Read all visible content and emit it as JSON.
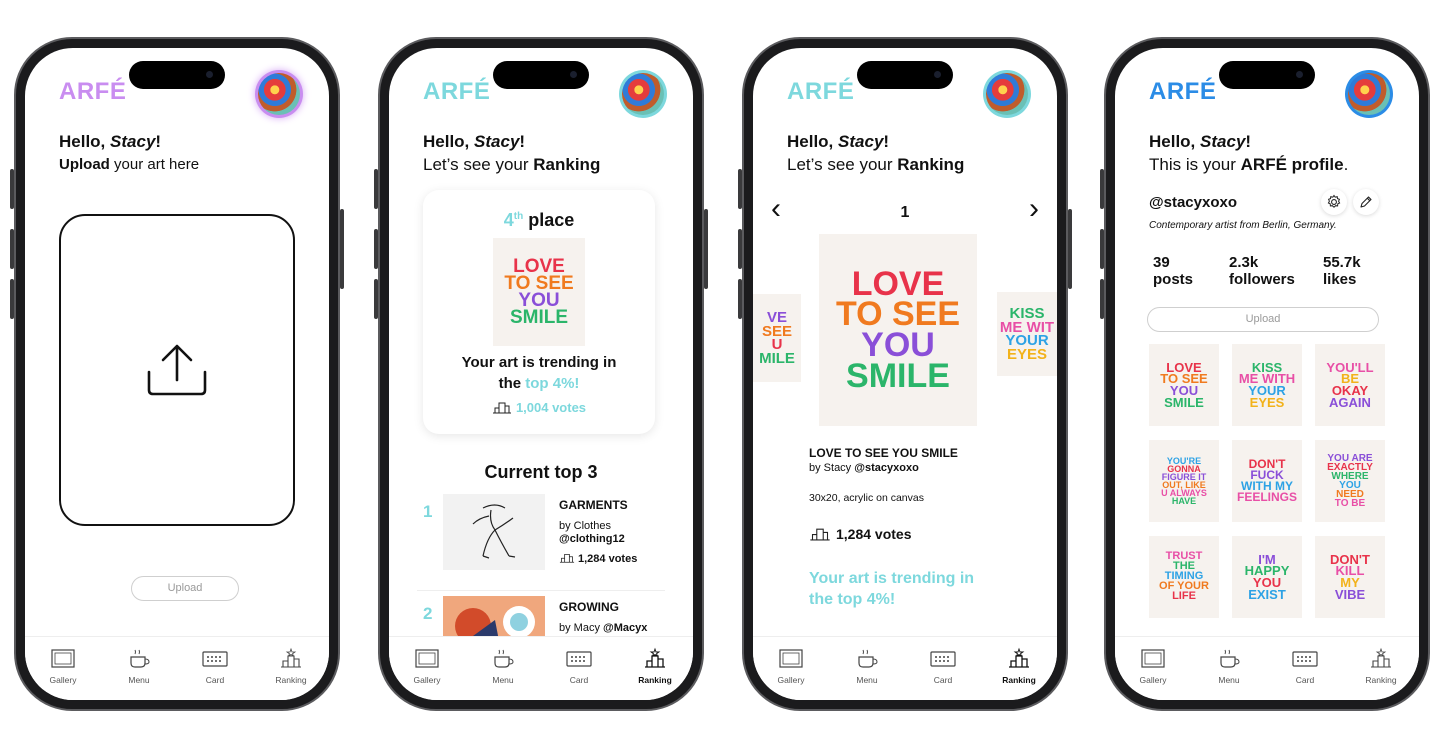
{
  "logo_text": "ARFÉ",
  "nav": [
    {
      "label": "Gallery",
      "icon": "gallery-icon"
    },
    {
      "label": "Menu",
      "icon": "coffee-cup-icon"
    },
    {
      "label": "Card",
      "icon": "card-icon"
    },
    {
      "label": "Ranking",
      "icon": "podium-icon"
    }
  ],
  "phones": [
    {
      "accent": "#c98df0",
      "greeting": "Hello,",
      "name": "Stacy",
      "subtitle_bold": "Upload",
      "subtitle_rest": " your art here",
      "upload_button": "Upload",
      "active_tab": "Gallery"
    },
    {
      "accent": "#7dd8dd",
      "greeting": "Hello,",
      "name": "Stacy",
      "subtitle_rest": "Let’s see your ",
      "subtitle_bold": "Ranking",
      "place_num": "4",
      "place_sup": "th",
      "place_word": " place",
      "art_lines": [
        "LOVE",
        "TO SEE",
        "YOU",
        "SMILE"
      ],
      "trend_line1": "Your art is trending in",
      "trend_line2_pre": "the ",
      "trend_highlight": "top 4%!",
      "votes": "1,004 votes",
      "top3_title": "Current top 3",
      "top3": [
        {
          "rank": "1",
          "title": "GARMENTS",
          "by_prefix": "by Clothes",
          "handle": "@clothing12",
          "votes": "1,284 votes"
        },
        {
          "rank": "2",
          "title": "GROWING",
          "by_prefix": "by Macy",
          "handle": "@Macyx"
        }
      ],
      "active_tab": "Ranking"
    },
    {
      "accent": "#7dd8dd",
      "greeting": "Hello,",
      "name": "Stacy",
      "subtitle_rest": "Let’s see your ",
      "subtitle_bold": "Ranking",
      "pager_prev": "‹",
      "pager_next": "›",
      "pager_number": "1",
      "main_art_lines": [
        "LOVE",
        "TO SEE",
        "YOU",
        "SMILE"
      ],
      "left_art_lines": [
        "VE",
        "SEE",
        "U",
        "MILE"
      ],
      "right_art_lines": [
        "KISS",
        "ME WIT",
        "YOUR",
        "EYES"
      ],
      "art_title": "LOVE TO SEE YOU SMILE",
      "art_by_prefix": "by Stacy",
      "art_handle": "@stacyxoxo",
      "art_meta": "30x20, acrylic on canvas",
      "votes": "1,284 votes",
      "trend_line1": "Your art is trending in",
      "trend_line2": "the top 4%!",
      "active_tab": "Ranking"
    },
    {
      "accent": "#2b8ce6",
      "greeting": "Hello,",
      "name": "Stacy",
      "subtitle_rest": "This is your ",
      "subtitle_bold": "ARFÉ profile",
      "subtitle_end": ".",
      "handle": "@stacyxoxo",
      "bio": "Contemporary artist from Berlin, Germany.",
      "stats": [
        {
          "value": "39",
          "label": "posts"
        },
        {
          "value": "2.3k",
          "label": "followers"
        },
        {
          "value": "55.7k",
          "label": "likes"
        }
      ],
      "upload_button": "Upload",
      "gallery": [
        [
          "LOVE",
          "TO SEE",
          "YOU",
          "SMILE"
        ],
        [
          "KISS",
          "ME WITH",
          "YOUR",
          "EYES"
        ],
        [
          "YOU'LL",
          "BE",
          "OKAY",
          "AGAIN"
        ],
        [
          "YOU'RE",
          "GONNA",
          "FIGURE IT",
          "OUT, LIKE",
          "U ALWAYS",
          "HAVE"
        ],
        [
          "DON'T",
          "FUCK",
          "WITH MY",
          "FEELINGS"
        ],
        [
          "YOU ARE",
          "EXACTLY",
          "WHERE",
          "YOU",
          "NEED",
          "TO BE"
        ],
        [
          "TRUST",
          "THE",
          "TIMING",
          "OF YOUR",
          "LIFE"
        ],
        [
          "I'M",
          "HAPPY",
          "YOU",
          "EXIST"
        ],
        [
          "DON'T",
          "KILL",
          "MY",
          "VIBE"
        ]
      ],
      "active_tab": "Ranking"
    }
  ]
}
